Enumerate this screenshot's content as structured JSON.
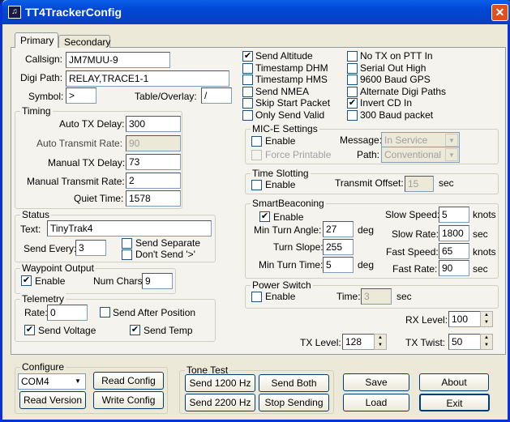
{
  "window": {
    "title": "TT4TrackerConfig",
    "close": "✕"
  },
  "tabs": [
    {
      "label": "Primary"
    },
    {
      "label": "Secondary"
    }
  ],
  "primary": {
    "callsign": {
      "label": "Callsign:",
      "value": "JM7MUU-9"
    },
    "digi_path": {
      "label": "Digi Path:",
      "value": "RELAY,TRACE1-1"
    },
    "symbol": {
      "label": "Symbol:",
      "value": ">"
    },
    "table_overlay": {
      "label": "Table/Overlay:",
      "value": "/"
    },
    "timing": {
      "title": "Timing",
      "auto_tx_delay": {
        "label": "Auto TX Delay:",
        "value": "300"
      },
      "auto_transmit_rate": {
        "label": "Auto Transmit Rate:",
        "value": "90"
      },
      "manual_tx_delay": {
        "label": "Manual TX Delay:",
        "value": "73"
      },
      "manual_transmit_rate": {
        "label": "Manual Transmit Rate:",
        "value": "2"
      },
      "quiet_time": {
        "label": "Quiet Time:",
        "value": "1578"
      }
    },
    "status": {
      "title": "Status",
      "text_label": "Text:",
      "text": "TinyTrak4",
      "send_every_label": "Send Every:",
      "send_every": "3",
      "send_separate": "Send Separate",
      "dont_send": "Don't Send '>'"
    },
    "waypoint": {
      "title": "Waypoint Output",
      "enable": "Enable",
      "num_chars_label": "Num Chars:",
      "num_chars": "9"
    },
    "telemetry": {
      "title": "Telemetry",
      "rate_label": "Rate:",
      "rate": "0",
      "send_after_position": "Send After Position",
      "send_voltage": "Send Voltage",
      "send_temp": "Send Temp"
    },
    "checks_left": [
      {
        "label": "Send Altitude",
        "checked": true
      },
      {
        "label": "Timestamp DHM",
        "checked": false
      },
      {
        "label": "Timestamp HMS",
        "checked": false
      },
      {
        "label": "Send NMEA",
        "checked": false
      },
      {
        "label": "Skip Start Packet",
        "checked": false
      },
      {
        "label": "Only Send Valid",
        "checked": false
      }
    ],
    "checks_right": [
      {
        "label": "No TX on PTT In",
        "checked": false
      },
      {
        "label": "Serial Out High",
        "checked": false
      },
      {
        "label": "9600 Baud GPS",
        "checked": false
      },
      {
        "label": "Alternate Digi Paths",
        "checked": false
      },
      {
        "label": "Invert CD In",
        "checked": true
      },
      {
        "label": "300 Baud packet",
        "checked": false
      }
    ],
    "mice": {
      "title": "MIC-E Settings",
      "enable": "Enable",
      "force_printable": "Force Printable",
      "message_label": "Message:",
      "message": "In Service",
      "path_label": "Path:",
      "path": "Conventional"
    },
    "time_slotting": {
      "title": "Time Slotting",
      "enable": "Enable",
      "offset_label": "Transmit Offset:",
      "offset": "15",
      "unit": "sec"
    },
    "smart": {
      "title": "SmartBeaconing",
      "enable": "Enable",
      "min_turn_angle_label": "Min Turn Angle:",
      "min_turn_angle": "27",
      "deg": "deg",
      "turn_slope_label": "Turn Slope:",
      "turn_slope": "255",
      "min_turn_time_label": "Min Turn Time:",
      "min_turn_time": "5",
      "slow_speed_label": "Slow Speed:",
      "slow_speed": "5",
      "knots": "knots",
      "slow_rate_label": "Slow Rate:",
      "slow_rate": "1800",
      "sec": "sec",
      "fast_speed_label": "Fast Speed:",
      "fast_speed": "65",
      "fast_rate_label": "Fast Rate:",
      "fast_rate": "90"
    },
    "power": {
      "title": "Power Switch",
      "enable": "Enable",
      "time_label": "Time:",
      "time": "3",
      "unit": "sec"
    },
    "rx_level": {
      "label": "RX Level:",
      "value": "100"
    },
    "tx_level": {
      "label": "TX Level:",
      "value": "128"
    },
    "tx_twist": {
      "label": "TX Twist:",
      "value": "50"
    }
  },
  "configure": {
    "title": "Configure",
    "port": "COM4",
    "read_config": "Read Config",
    "read_version": "Read Version",
    "write_config": "Write Config"
  },
  "tone_test": {
    "title": "Tone Test",
    "send_1200": "Send 1200 Hz",
    "send_both": "Send Both",
    "send_2200": "Send 2200 Hz",
    "stop": "Stop Sending"
  },
  "buttons": {
    "save": "Save",
    "about": "About",
    "load": "Load",
    "exit": "Exit"
  }
}
